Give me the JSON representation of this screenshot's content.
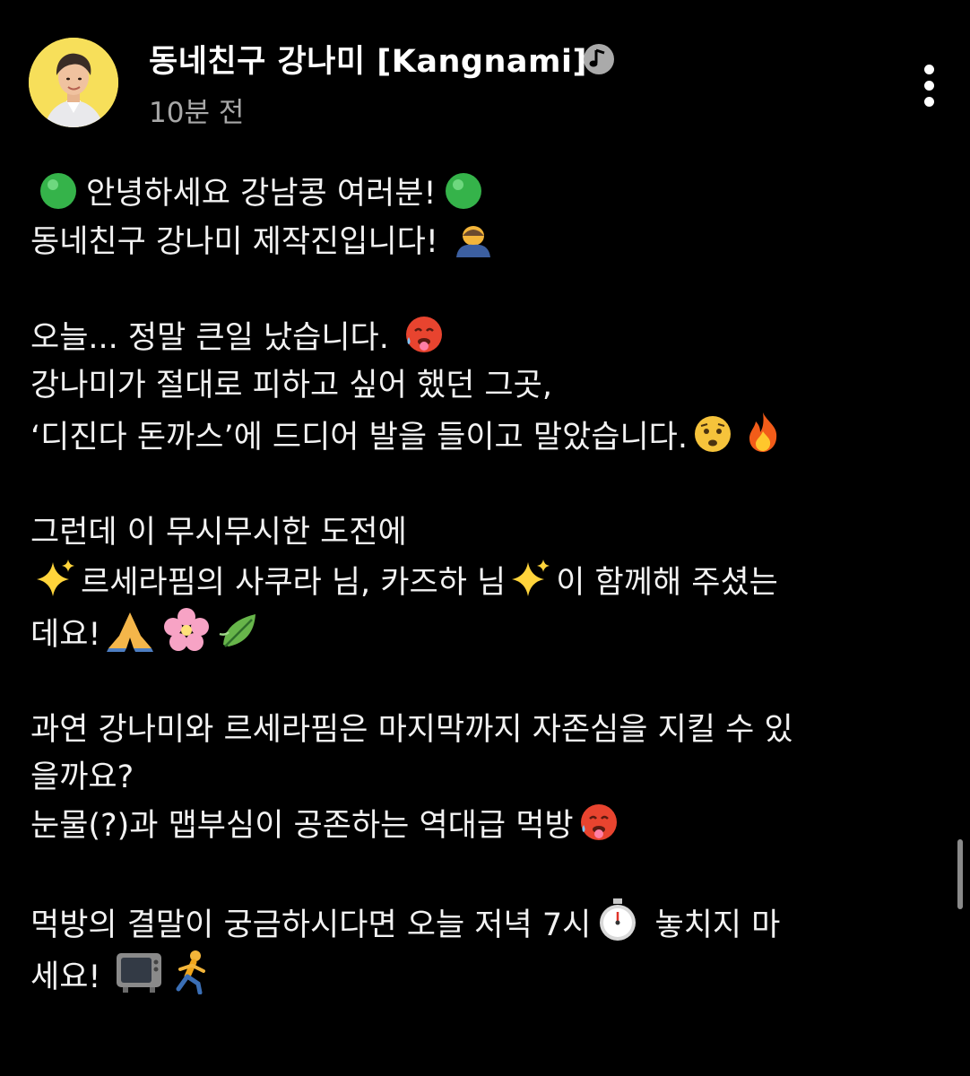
{
  "header": {
    "channel_name": "동네친구 강나미 [Kangnami]",
    "time_ago": "10분 전"
  },
  "post": {
    "l1a": "안녕하세요 강남콩 여러분!",
    "l2": "동네친구 강나미 제작진입니다!",
    "l3": "오늘... 정말 큰일 났습니다.",
    "l4": "강나미가 절대로 피하고 싶어 했던 그곳,",
    "l5": "‘디진다 돈까스’에 드디어 발을 들이고 말았습니다.",
    "l6": "그런데 이 무시무시한 도전에",
    "l7a": "르세라핌의 사쿠라 님, 카즈하 님",
    "l7b": "이 함께해 주셨는",
    "l8": "데요!",
    "l9": "과연 강나미와 르세라핌은 마지막까지 자존심을 지킬 수 있",
    "l10": "을까요?",
    "l11": "눈물(?)과 맵부심이 공존하는 역대급 먹방",
    "l12a": "먹방의 결말이 궁금하시다면 오늘 저녁 7시",
    "l12b": "놓치지 마",
    "l13": "세요!"
  },
  "icons": [
    "green-circle-icon",
    "bowing-person-icon",
    "hot-face-icon",
    "anxious-face-icon",
    "fire-icon",
    "sparkles-icon",
    "folded-hands-icon",
    "cherry-blossom-icon",
    "leaf-icon",
    "stopwatch-icon",
    "tv-icon",
    "running-person-icon",
    "verified-badge-icon",
    "more-options-icon"
  ],
  "colors": {
    "background": "#000000",
    "text": "#f2f2f2",
    "secondary_text": "#a8a8a8"
  }
}
